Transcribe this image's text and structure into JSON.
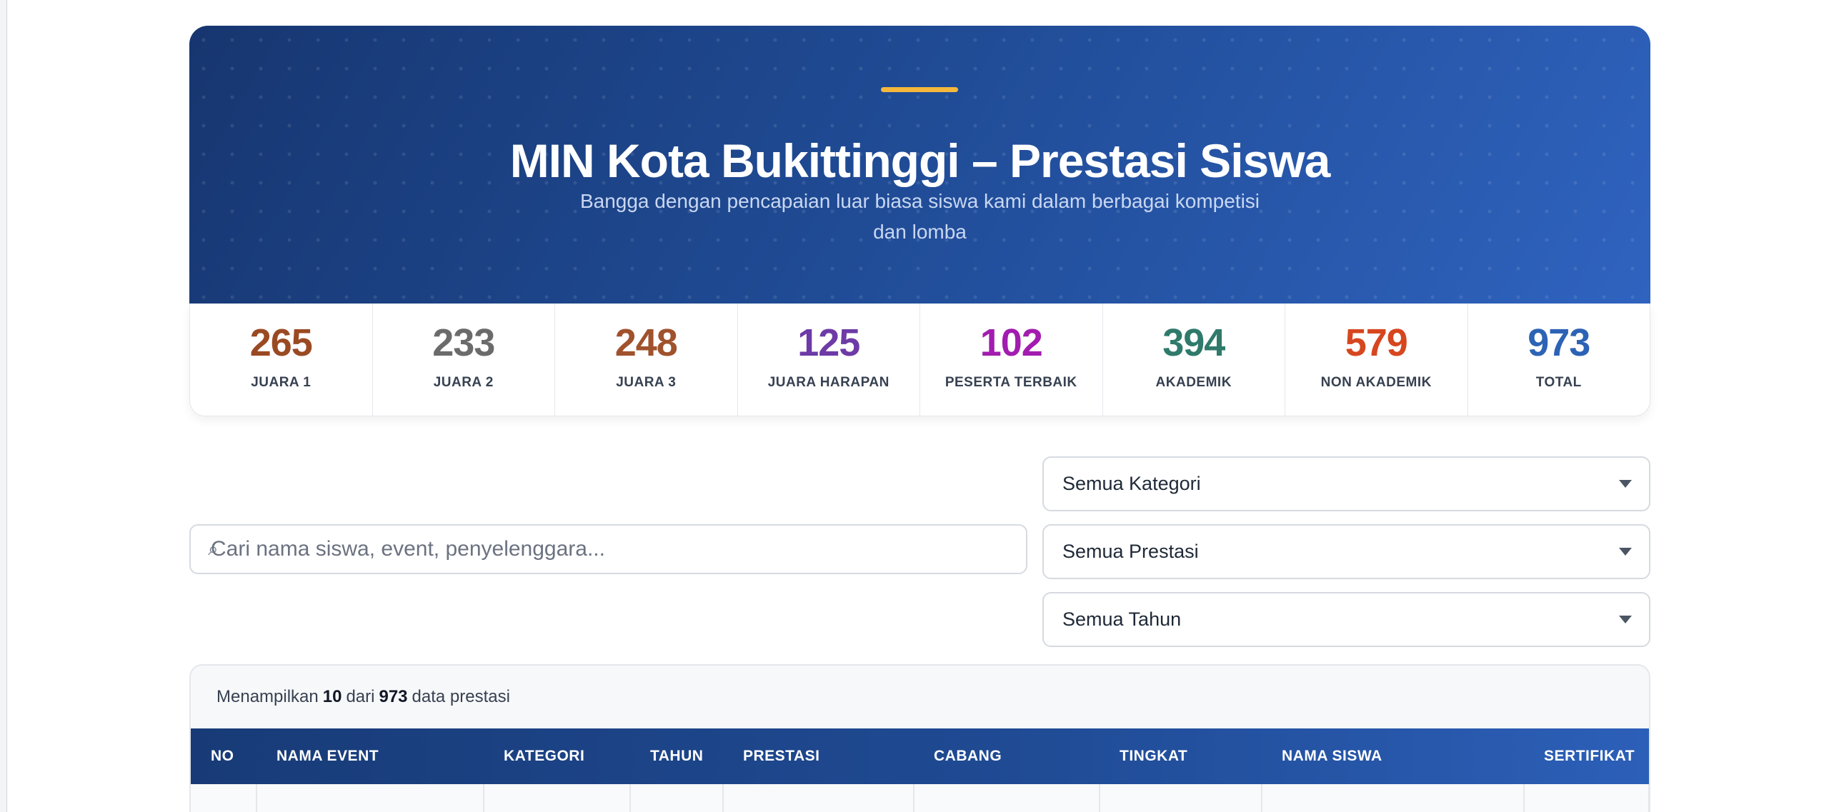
{
  "hero": {
    "title": "MIN Kota Bukittinggi – Prestasi Siswa",
    "subtitle": "Bangga dengan pencapaian luar biasa siswa kami dalam berbagai kompetisi dan lomba"
  },
  "stats": [
    {
      "value": "265",
      "label": "JUARA 1",
      "color": "#9a4a22"
    },
    {
      "value": "233",
      "label": "JUARA 2",
      "color": "#6b6b6b"
    },
    {
      "value": "248",
      "label": "JUARA 3",
      "color": "#a0522d"
    },
    {
      "value": "125",
      "label": "JUARA HARAPAN",
      "color": "#6d3aa6"
    },
    {
      "value": "102",
      "label": "PESERTA TERBAIK",
      "color": "#a21caf"
    },
    {
      "value": "394",
      "label": "AKADEMIK",
      "color": "#2f7a6b"
    },
    {
      "value": "579",
      "label": "NON AKADEMIK",
      "color": "#d6461f"
    },
    {
      "value": "973",
      "label": "TOTAL",
      "color": "#2d63b5"
    }
  ],
  "search": {
    "icon": "search-icon",
    "placeholder": "Cari nama siswa, event, penyelenggara..."
  },
  "filters": {
    "kategori": "Semua Kategori",
    "prestasi": "Semua Prestasi",
    "tahun": "Semua Tahun"
  },
  "table": {
    "info_prefix": "Menampilkan",
    "shown": "10",
    "info_mid": "dari",
    "total": "973",
    "info_suffix": "data prestasi",
    "headers": [
      "NO",
      "NAMA EVENT",
      "KATEGORI",
      "TAHUN",
      "PRESTASI",
      "CABANG",
      "TINGKAT",
      "NAMA SISWA",
      "SERTIFIKAT"
    ]
  }
}
